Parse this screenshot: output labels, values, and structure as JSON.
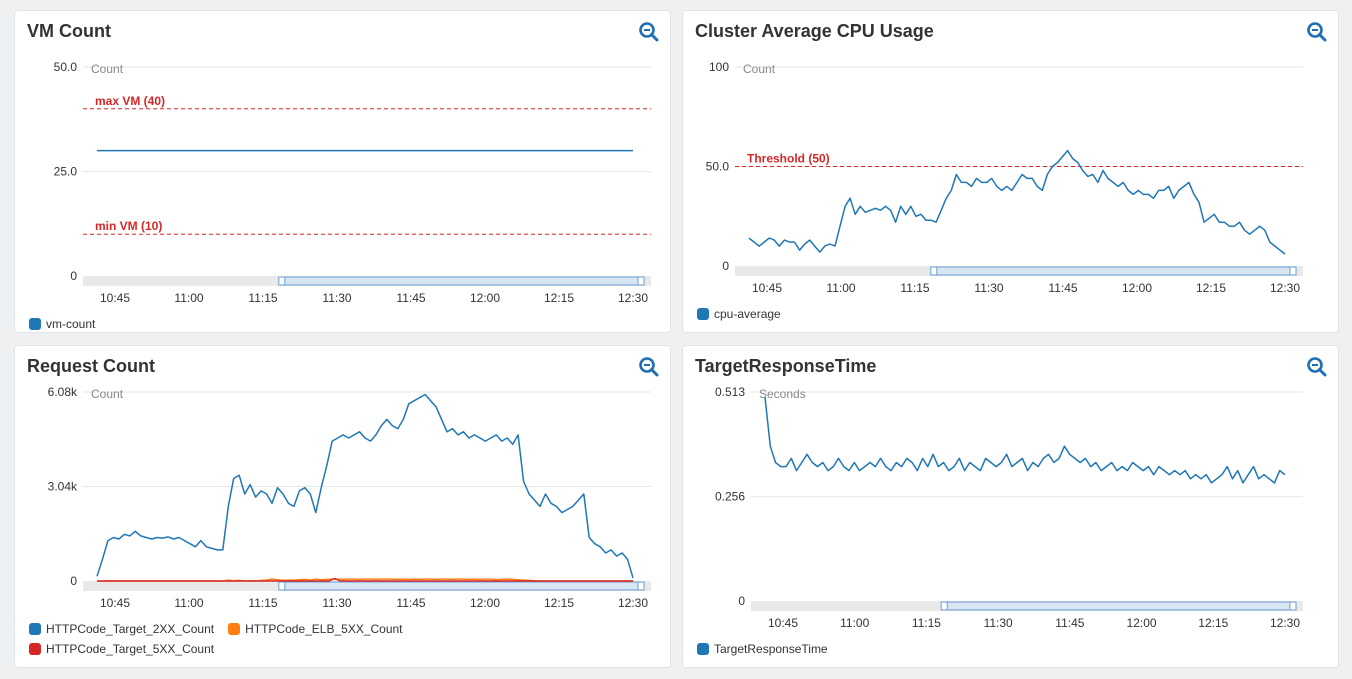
{
  "panels": [
    {
      "title": "VM Count",
      "chart_data": {
        "type": "line",
        "title": "VM Count",
        "ylabel": "Count",
        "ylim": [
          0,
          50
        ],
        "y_ticks": [
          "0",
          "25.0",
          "50.0"
        ],
        "y_tick_values": [
          0,
          25,
          50
        ],
        "x_ticks": [
          "10:45",
          "11:00",
          "11:15",
          "11:30",
          "11:45",
          "12:00",
          "12:15",
          "12:30"
        ],
        "annotations": [
          {
            "label": "max VM (40)",
            "value": 40,
            "color": "#d62728"
          },
          {
            "label": "min VM (10)",
            "value": 10,
            "color": "#d62728"
          }
        ],
        "series": [
          {
            "name": "vm-count",
            "color": "#1f77b4",
            "values": [
              30,
              30,
              30,
              30,
              30,
              30,
              30,
              30,
              30,
              30,
              30,
              30,
              30,
              30,
              30,
              30,
              30,
              30,
              30,
              30,
              30,
              30,
              30,
              30,
              30,
              30,
              30,
              30,
              30,
              30,
              30,
              30,
              30,
              30,
              30,
              30,
              30,
              30,
              30,
              30,
              30,
              30,
              30,
              30,
              30,
              30,
              30,
              30,
              30,
              30,
              30,
              30,
              30,
              30,
              30,
              30,
              30,
              30,
              30,
              30,
              30,
              30,
              30,
              30,
              30,
              30,
              30,
              30,
              30,
              30,
              30,
              30,
              30,
              30,
              30,
              30,
              30,
              30,
              30,
              30,
              30,
              30,
              30,
              30,
              30,
              30,
              30,
              30,
              30,
              30,
              30,
              30,
              30,
              30,
              30,
              30,
              30,
              30,
              30,
              30,
              30,
              30,
              30,
              30,
              30,
              30,
              30
            ]
          }
        ],
        "legend": "bottom-left"
      }
    },
    {
      "title": "Cluster Average CPU Usage",
      "chart_data": {
        "type": "line",
        "title": "Cluster Average CPU Usage",
        "ylabel": "Count",
        "ylim": [
          0,
          100
        ],
        "y_ticks": [
          "0",
          "50.0",
          "100"
        ],
        "y_tick_values": [
          0,
          50,
          100
        ],
        "x_ticks": [
          "10:45",
          "11:00",
          "11:15",
          "11:30",
          "11:45",
          "12:00",
          "12:15",
          "12:30"
        ],
        "annotations": [
          {
            "label": "Threshold (50)",
            "value": 50,
            "color": "#d62728"
          }
        ],
        "series": [
          {
            "name": "cpu-average",
            "color": "#1f77b4",
            "values": [
              14,
              12,
              10,
              12,
              14,
              13,
              10,
              13,
              12,
              12,
              8,
              11,
              13,
              10,
              7,
              10,
              11,
              10,
              20,
              30,
              34,
              26,
              30,
              27,
              28,
              29,
              28,
              30,
              28,
              22,
              30,
              26,
              30,
              25,
              26,
              23,
              23,
              22,
              28,
              34,
              38,
              46,
              42,
              42,
              40,
              44,
              42,
              42,
              44,
              40,
              38,
              40,
              38,
              42,
              46,
              44,
              44,
              40,
              38,
              46,
              50,
              52,
              55,
              58,
              54,
              52,
              48,
              45,
              46,
              42,
              48,
              44,
              42,
              40,
              42,
              38,
              36,
              38,
              36,
              36,
              34,
              38,
              38,
              40,
              34,
              38,
              40,
              42,
              36,
              32,
              22,
              24,
              26,
              22,
              22,
              20,
              20,
              22,
              18,
              16,
              18,
              20,
              18,
              12,
              10,
              8,
              6
            ]
          }
        ],
        "legend": "bottom-left"
      }
    },
    {
      "title": "Request Count",
      "chart_data": {
        "type": "line",
        "title": "Request Count",
        "ylabel": "Count",
        "ylim": [
          0,
          6080
        ],
        "y_ticks": [
          "0",
          "3.04k",
          "6.08k"
        ],
        "y_tick_values": [
          0,
          3040,
          6080
        ],
        "x_ticks": [
          "10:45",
          "11:00",
          "11:15",
          "11:30",
          "11:45",
          "12:00",
          "12:15",
          "12:30"
        ],
        "series": [
          {
            "name": "HTTPCode_Target_2XX_Count",
            "color": "#1f77b4",
            "values": [
              150,
              700,
              1300,
              1400,
              1350,
              1500,
              1450,
              1600,
              1450,
              1400,
              1350,
              1400,
              1380,
              1420,
              1350,
              1400,
              1300,
              1200,
              1100,
              1300,
              1100,
              1050,
              1000,
              1000,
              2400,
              3300,
              3400,
              2800,
              3100,
              2700,
              2900,
              2800,
              2500,
              3000,
              2800,
              2500,
              2400,
              2900,
              3000,
              2800,
              2200,
              3000,
              3700,
              4500,
              4600,
              4700,
              4600,
              4700,
              4800,
              4600,
              4500,
              4700,
              5000,
              5200,
              5000,
              4900,
              5200,
              5700,
              5800,
              5900,
              6000,
              5800,
              5600,
              5200,
              4800,
              4900,
              4700,
              4800,
              4600,
              4700,
              4600,
              4500,
              4600,
              4700,
              4500,
              4600,
              4400,
              4700,
              3200,
              2800,
              2600,
              2400,
              2800,
              2500,
              2400,
              2200,
              2300,
              2400,
              2600,
              2800,
              1400,
              1200,
              1100,
              900,
              1000,
              800,
              900,
              700,
              100
            ]
          },
          {
            "name": "HTTPCode_ELB_5XX_Count",
            "color": "#ff7f0e",
            "values": [
              0,
              0,
              0,
              0,
              0,
              0,
              0,
              0,
              0,
              0,
              0,
              0,
              0,
              0,
              0,
              0,
              0,
              0,
              0,
              0,
              0,
              0,
              0,
              0,
              30,
              10,
              20,
              0,
              10,
              0,
              20,
              30,
              60,
              40,
              20,
              30,
              30,
              40,
              50,
              30,
              60,
              40,
              50,
              60,
              60,
              50,
              60,
              60,
              50,
              60,
              60,
              50,
              60,
              60,
              60,
              50,
              60,
              50,
              60,
              50,
              60,
              60,
              50,
              60,
              60,
              50,
              60,
              60,
              50,
              60,
              50,
              60,
              60,
              40,
              50,
              60,
              50,
              40,
              30,
              20,
              10,
              0,
              0,
              0,
              0,
              0,
              0,
              0,
              0,
              0,
              0,
              0,
              0,
              0,
              0,
              0,
              0,
              0,
              0
            ]
          },
          {
            "name": "HTTPCode_Target_5XX_Count",
            "color": "#d62728",
            "values": [
              0,
              0,
              0,
              0,
              0,
              0,
              0,
              0,
              0,
              0,
              0,
              0,
              0,
              0,
              0,
              0,
              0,
              0,
              0,
              0,
              0,
              0,
              0,
              0,
              0,
              0,
              0,
              0,
              0,
              0,
              0,
              0,
              0,
              0,
              0,
              0,
              0,
              0,
              0,
              0,
              0,
              0,
              0,
              80,
              0,
              0,
              0,
              0,
              0,
              0,
              0,
              0,
              0,
              0,
              0,
              0,
              0,
              0,
              0,
              0,
              0,
              0,
              0,
              0,
              0,
              0,
              0,
              0,
              0,
              0,
              0,
              0,
              0,
              0,
              0,
              0,
              0,
              0,
              0,
              0,
              0,
              0,
              0,
              0,
              0,
              0,
              0,
              0,
              0,
              0,
              0,
              0,
              0,
              0,
              0,
              0,
              0,
              0
            ]
          }
        ],
        "legend": "bottom-left"
      }
    },
    {
      "title": "TargetResponseTime",
      "chart_data": {
        "type": "line",
        "title": "TargetResponseTime",
        "ylabel": "Seconds",
        "ylim": [
          0,
          0.513
        ],
        "y_ticks": [
          "0",
          "0.256",
          "0.513"
        ],
        "y_tick_values": [
          0,
          0.256,
          0.513
        ],
        "x_ticks": [
          "10:45",
          "11:00",
          "11:15",
          "11:30",
          "11:45",
          "12:00",
          "12:15",
          "12:30"
        ],
        "series": [
          {
            "name": "TargetResponseTime",
            "color": "#1f77b4",
            "values": [
              0.5,
              0.38,
              0.34,
              0.33,
              0.33,
              0.35,
              0.32,
              0.34,
              0.36,
              0.34,
              0.33,
              0.34,
              0.32,
              0.33,
              0.35,
              0.33,
              0.32,
              0.34,
              0.32,
              0.33,
              0.34,
              0.33,
              0.35,
              0.33,
              0.32,
              0.34,
              0.33,
              0.35,
              0.34,
              0.32,
              0.35,
              0.33,
              0.36,
              0.33,
              0.34,
              0.32,
              0.33,
              0.35,
              0.32,
              0.34,
              0.33,
              0.32,
              0.35,
              0.34,
              0.33,
              0.34,
              0.36,
              0.33,
              0.34,
              0.35,
              0.32,
              0.34,
              0.33,
              0.35,
              0.36,
              0.34,
              0.35,
              0.38,
              0.36,
              0.35,
              0.34,
              0.35,
              0.33,
              0.34,
              0.32,
              0.33,
              0.34,
              0.32,
              0.33,
              0.32,
              0.34,
              0.33,
              0.32,
              0.33,
              0.31,
              0.33,
              0.32,
              0.31,
              0.32,
              0.31,
              0.32,
              0.3,
              0.31,
              0.3,
              0.31,
              0.29,
              0.3,
              0.31,
              0.33,
              0.3,
              0.32,
              0.29,
              0.31,
              0.33,
              0.3,
              0.31,
              0.3,
              0.29,
              0.32,
              0.31
            ]
          }
        ],
        "legend": "bottom-left"
      }
    }
  ]
}
